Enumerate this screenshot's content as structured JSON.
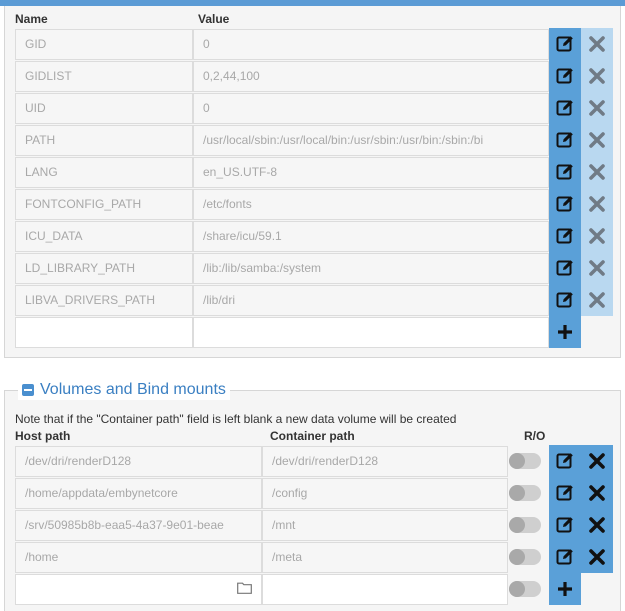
{
  "env": {
    "headers": {
      "name": "Name",
      "value": "Value"
    },
    "rows": [
      {
        "name": "GID",
        "value": "0"
      },
      {
        "name": "GIDLIST",
        "value": "0,2,44,100"
      },
      {
        "name": "UID",
        "value": "0"
      },
      {
        "name": "PATH",
        "value": "/usr/local/sbin:/usr/local/bin:/usr/sbin:/usr/bin:/sbin:/bi"
      },
      {
        "name": "LANG",
        "value": "en_US.UTF-8"
      },
      {
        "name": "FONTCONFIG_PATH",
        "value": "/etc/fonts"
      },
      {
        "name": "ICU_DATA",
        "value": "/share/icu/59.1"
      },
      {
        "name": "LD_LIBRARY_PATH",
        "value": "/lib:/lib/samba:/system"
      },
      {
        "name": "LIBVA_DRIVERS_PATH",
        "value": "/lib/dri"
      }
    ],
    "new_row": {
      "name": "",
      "value": ""
    }
  },
  "volumes": {
    "legend": "Volumes and Bind mounts",
    "note": "Note that if the \"Container path\" field is left blank a new data volume will be created",
    "headers": {
      "host": "Host path",
      "container": "Container path",
      "ro": "R/O"
    },
    "rows": [
      {
        "host": "/dev/dri/renderD128",
        "container": "/dev/dri/renderD128",
        "ro": false
      },
      {
        "host": "/home/appdata/embynetcore",
        "container": "/config",
        "ro": false
      },
      {
        "host": "/srv/50985b8b-eaa5-4a37-9e01-beae",
        "container": "/mnt",
        "ro": false
      },
      {
        "host": "/home",
        "container": "/meta",
        "ro": false
      }
    ],
    "new_row": {
      "host": "",
      "container": "",
      "ro": false
    }
  },
  "colors": {
    "accent": "#5aa0d8",
    "accent_light": "#b9d8f0",
    "legend": "#3a7fc2"
  },
  "icons": {
    "edit": "edit-icon",
    "delete": "delete-icon",
    "add": "add-icon",
    "folder": "folder-icon",
    "collapse": "collapse-icon"
  }
}
